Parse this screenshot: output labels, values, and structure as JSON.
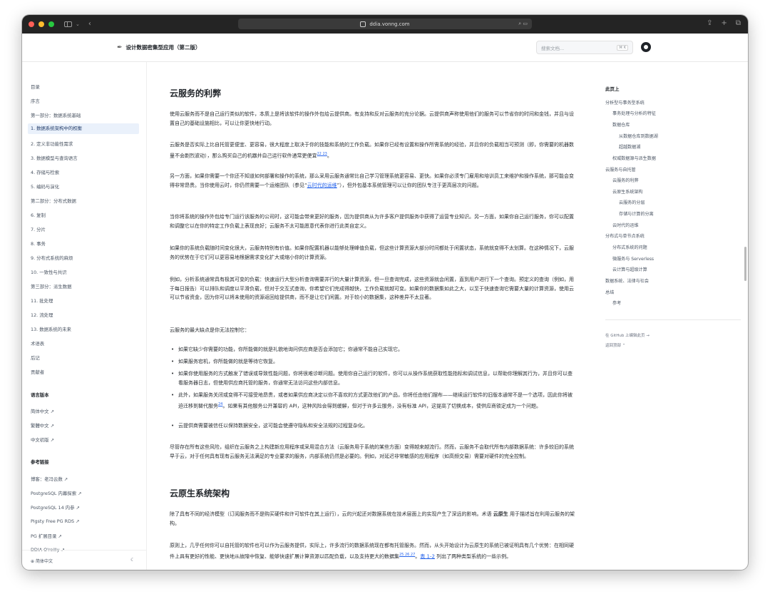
{
  "browser": {
    "url": "ddia.vonng.com"
  },
  "site": {
    "title": "设计数据密集型应用（第二版）",
    "search_placeholder": "搜索文档...",
    "search_shortcut": "⌘ K"
  },
  "sidebar": {
    "items": [
      "目录",
      "序言",
      "第一部分：数据系统基础",
      "1. 数据系统架构中的权衡",
      "2. 定义非功能性需求",
      "3. 数据模型与查询语言",
      "4. 存储与检索",
      "5. 编码与演化",
      "第二部分：分布式数据",
      "6. 复制",
      "7. 分片",
      "8. 事务",
      "9. 分布式系统的麻烦",
      "10. 一致性与共识",
      "第三部分：派生数据",
      "11. 批处理",
      "12. 流处理",
      "13. 数据系统的未来",
      "术语表",
      "后记",
      "贡献者"
    ],
    "lang_heading": "语言版本",
    "lang_items": [
      "简体中文 ↗",
      "繁體中文 ↗",
      "中文初版 ↗"
    ],
    "ref_heading": "参考链接",
    "ref_items": [
      "博客：老冯云数 ↗",
      "PostgreSQL 内幕探索 ↗",
      "PostgreSQL 14 内参 ↗",
      "Pigsty Free PG RDS ↗",
      "PG 扩展目录 ↗",
      "DDIA O'reilly ↗"
    ],
    "footer_lang": "简体中文"
  },
  "content": {
    "h2_1": "云服务的利弊",
    "p1": "使用云服务而不是自己运行类似的软件，本质上是将该软件的操作外包给云提供商。有支持和反对云服务的充分论据。云提供商声称使用他们的服务可以节省你的时间和金钱，并且与设置自己的基础设施相比，可以让你更快地行动。",
    "p2_a": "云服务是否实际上比自托管更便宜、更容易，很大程度上取决于你的技能和系统的工作负载。如果你已经有设置和操作所需系统的经验，并且你的负载相当可预测（即，你需要的机器数量不会剧烈波动），那么购买自己的机器并自己运行软件通常更便宜",
    "p2_sup": "22 23",
    "p2_b": "。",
    "p3_a": "另一方面，如果你需要一个你还不知道如何部署和操作的系统，那么采用云服务通常比自己学习管理系统更容易、更快。如果你必须专门雇用和培训员工来维护和操作系统，那可能会变得非常昂贵。当你使用云时，你仍然需要一个运维团队（参见“",
    "p3_link": "云时代的运维",
    "p3_b": "”），但外包基本系统管理可以让你的团队专注于更高层次的问题。",
    "p4": "当你将系统的操作外包给专门运行该服务的公司时，这可能会带来更好的服务，因为提供商从为许多客户提供服务中获得了运营专业知识。另一方面，如果你自己运行服务，你可以配置和调整它以在你的特定工作负载上表现良好；云服务不太可能愿意代表你进行此类自定义。",
    "p5": "如果你的系统负载随时间变化很大，云服务特别有价值。如果你配置机器以能够处理峰值负载，但这些计算资源大部分时间都处于闲置状态，系统就变得不太划算。在这种情况下，云服务的优势在于它们可以更容易地根据需求变化扩大或缩小你的计算资源。",
    "p6": "例如，分析系统通常具有极其可变的负载：快速运行大型分析查询需要并行的大量计算资源，但一旦查询完成，这些资源就会闲置，直到用户进行下一个查询。预定义的查询（例如，用于每日报告）可以排队和调度以平滑负载，但对于交互式查询，你希望它们完成得越快，工作负载就越可变。如果你的数据集如此之大，以至于快速查询它需要大量的计算资源，使用云可以节省资金，因为你可以将未使用的资源返回给提供商，而不是让它们闲置。对于较小的数据集，这种差异不太显著。",
    "p7": "云服务的最大缺点是你无法控制它：",
    "bullets": [
      "如果它缺少你需要的功能，你所能做的就是礼貌地询问供应商是否会添加它；你通常不能自己实现它。",
      "如果服务宕机，你所能做的就是等待它恢复。",
      "如果你使用服务的方式触发了错误或导致性能问题，你将很难诊断问题。使用你自己运行的软件，你可以从操作系统获取性能指标和调试信息，以帮助你理解其行为，并且你可以查看服务器日志，但使用供应商托管的服务，你通常无法访问这些内部信息。"
    ],
    "bullet4_a": "此外，如果服务关闭或变得不可接受地昂贵，或者如果供应商决定以你不喜欢的方式更改他们的产品，你将任由他们摆布——继续运行软件的旧版本通常不是一个选项，因此你将被迫迁移到替代服务",
    "bullet4_sup": "24",
    "bullet4_b": "。如果有其他服务公开兼容的 API，这种风险会得到缓解，但对于许多云服务，没有标准 API，这提高了切换成本，使供应商锁定成为一个问题。",
    "bullet5": "云提供商需要被信任以保持数据安全，这可能会使遵守隐私和安全法规的过程复杂化。",
    "p8": "尽管存在所有这些风险，组织在云服务之上构建新应用程序或采用混合方法（云服务用于系统的某些方面）变得越来越流行。然而，云服务不会取代所有内部数据系统：许多较旧的系统早于云，对于任何具有现有云服务无法满足的专业要求的服务，内部系统仍然是必要的。例如，对延迟非常敏感的应用程序（如高频交易）需要对硬件的完全控制。",
    "h2_2": "云原生系统架构",
    "p9_a": "除了具有不同的经济模型（订阅服务而不是购买硬件和许可软件在其上运行），云的兴起还对数据系统在技术层面上的实现产生了深远的影响。术语 ",
    "p9_bold": "云原生",
    "p9_b": " 用于描述旨在利用云服务的架构。",
    "p10_a": "原则上，几乎任何你可以自托管的软件也可以作为云服务提供，实际上，许多流行的数据系统现在都有托管服务。然而，从头开始设计为云原生的系统已被证明具有几个优势：在相同硬件上具有更好的性能、更快地从故障中恢复、能够快速扩展计算资源以匹配负载，以及支持更大的数据集",
    "p10_sup": "25 26 27",
    "p10_b": "。",
    "p10_link": "表 1-2",
    "p10_c": " 列出了两种类型系统的一些示例。"
  },
  "toc": {
    "title": "此页上",
    "items": [
      "分析型与事务型系统",
      "事务处理与分析的特征",
      "数据仓库",
      "从数据仓库到数据湖",
      "超越数据湖",
      "权威数据源与派生数据",
      "云服务与自托管",
      "云服务的利弊",
      "云原生系统架构",
      "云服务的分层",
      "存储与计算的分离",
      "云时代的运维",
      "分布式与单节点系统",
      "分布式系统的问题",
      "微服务与 Serverless",
      "云计算与超级计算",
      "数据系统、法律与社会",
      "总结",
      "参考"
    ],
    "edit_link": "在 GitHub 上编辑此页 →",
    "back_top": "返回顶部"
  }
}
